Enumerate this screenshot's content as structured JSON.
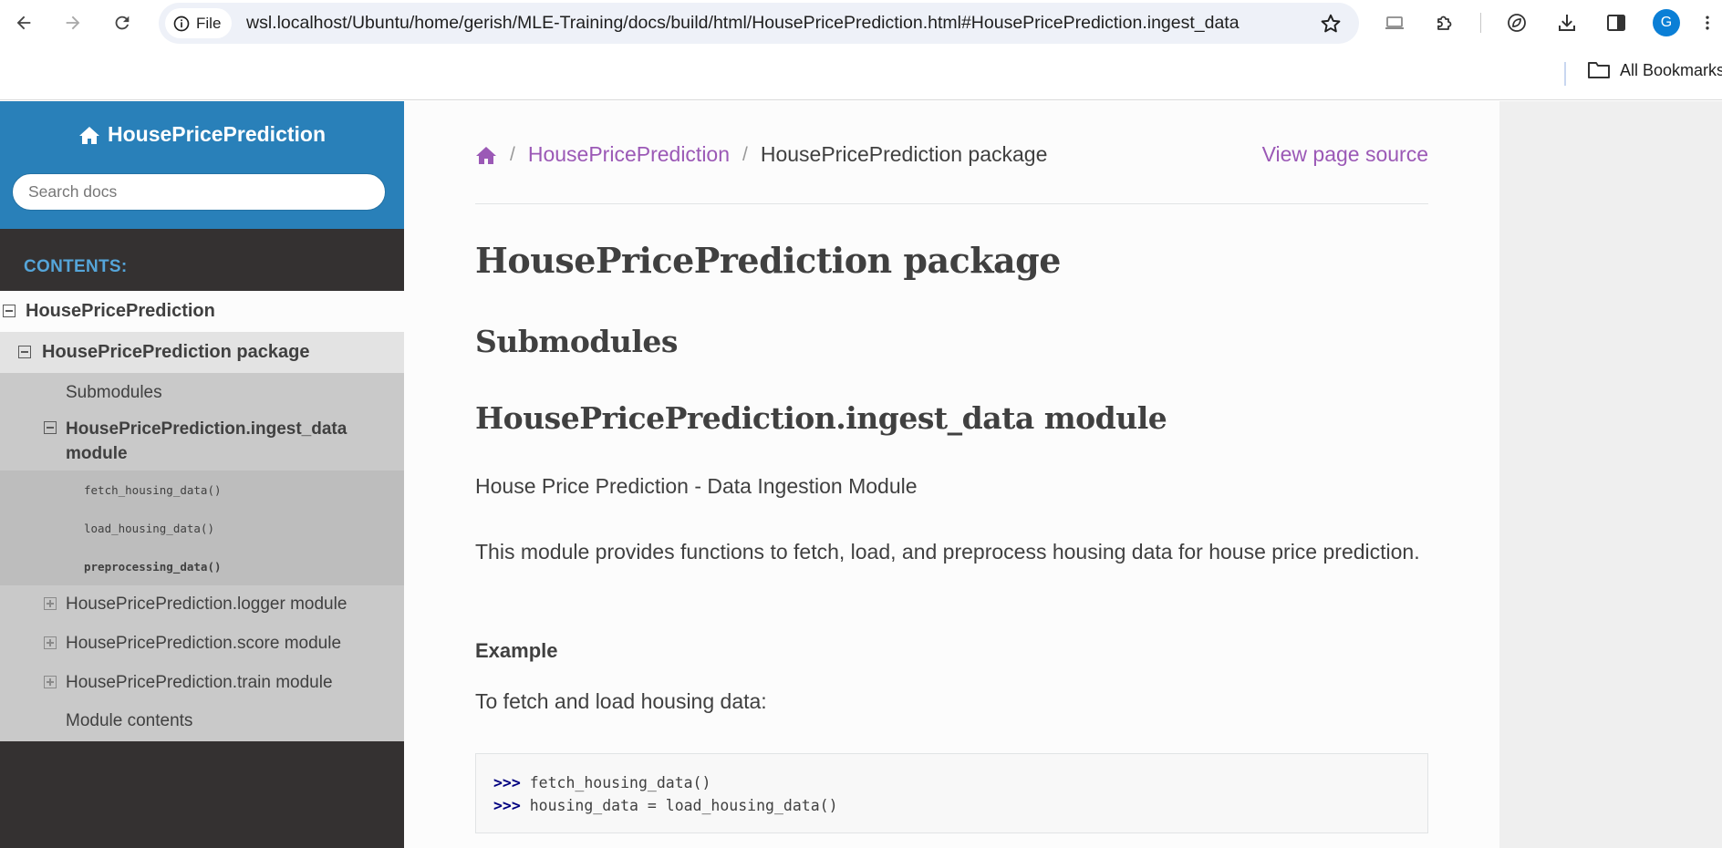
{
  "browser": {
    "site_info_label": "File",
    "url": "wsl.localhost/Ubuntu/home/gerish/MLE-Training/docs/build/html/HousePricePrediction.html#HousePricePrediction.ingest_data",
    "profile_initial": "G",
    "bookmarks_label": "All Bookmarks"
  },
  "sidebar": {
    "project_title": "HousePricePrediction",
    "search_placeholder": "Search docs",
    "caption": "CONTENTS:",
    "toc": {
      "root": "HousePricePrediction",
      "package": "HousePricePrediction package",
      "submodules": "Submodules",
      "ingest_line1": "HousePricePrediction.ingest_data",
      "ingest_line2": "module",
      "functions": [
        "fetch_housing_data()",
        "load_housing_data()",
        "preprocessing_data()"
      ],
      "logger": "HousePricePrediction.logger module",
      "score": "HousePricePrediction.score module",
      "train": "HousePricePrediction.train module",
      "module_contents": "Module contents"
    }
  },
  "content": {
    "breadcrumb_link": "HousePricePrediction",
    "breadcrumb_current": "HousePricePrediction package",
    "view_source": "View page source",
    "title": "HousePricePrediction package",
    "submodules_heading": "Submodules",
    "module_heading": "HousePricePrediction.ingest_data module",
    "intro": "House Price Prediction - Data Ingestion Module",
    "description": "This module provides functions to fetch, load, and preprocess housing data for house price prediction.",
    "example_heading": "Example",
    "example_text": "To fetch and load housing data:",
    "code": {
      "prompt": ">>>",
      "line1": "fetch_housing_data()",
      "line2": "housing_data = load_housing_data()"
    }
  }
}
